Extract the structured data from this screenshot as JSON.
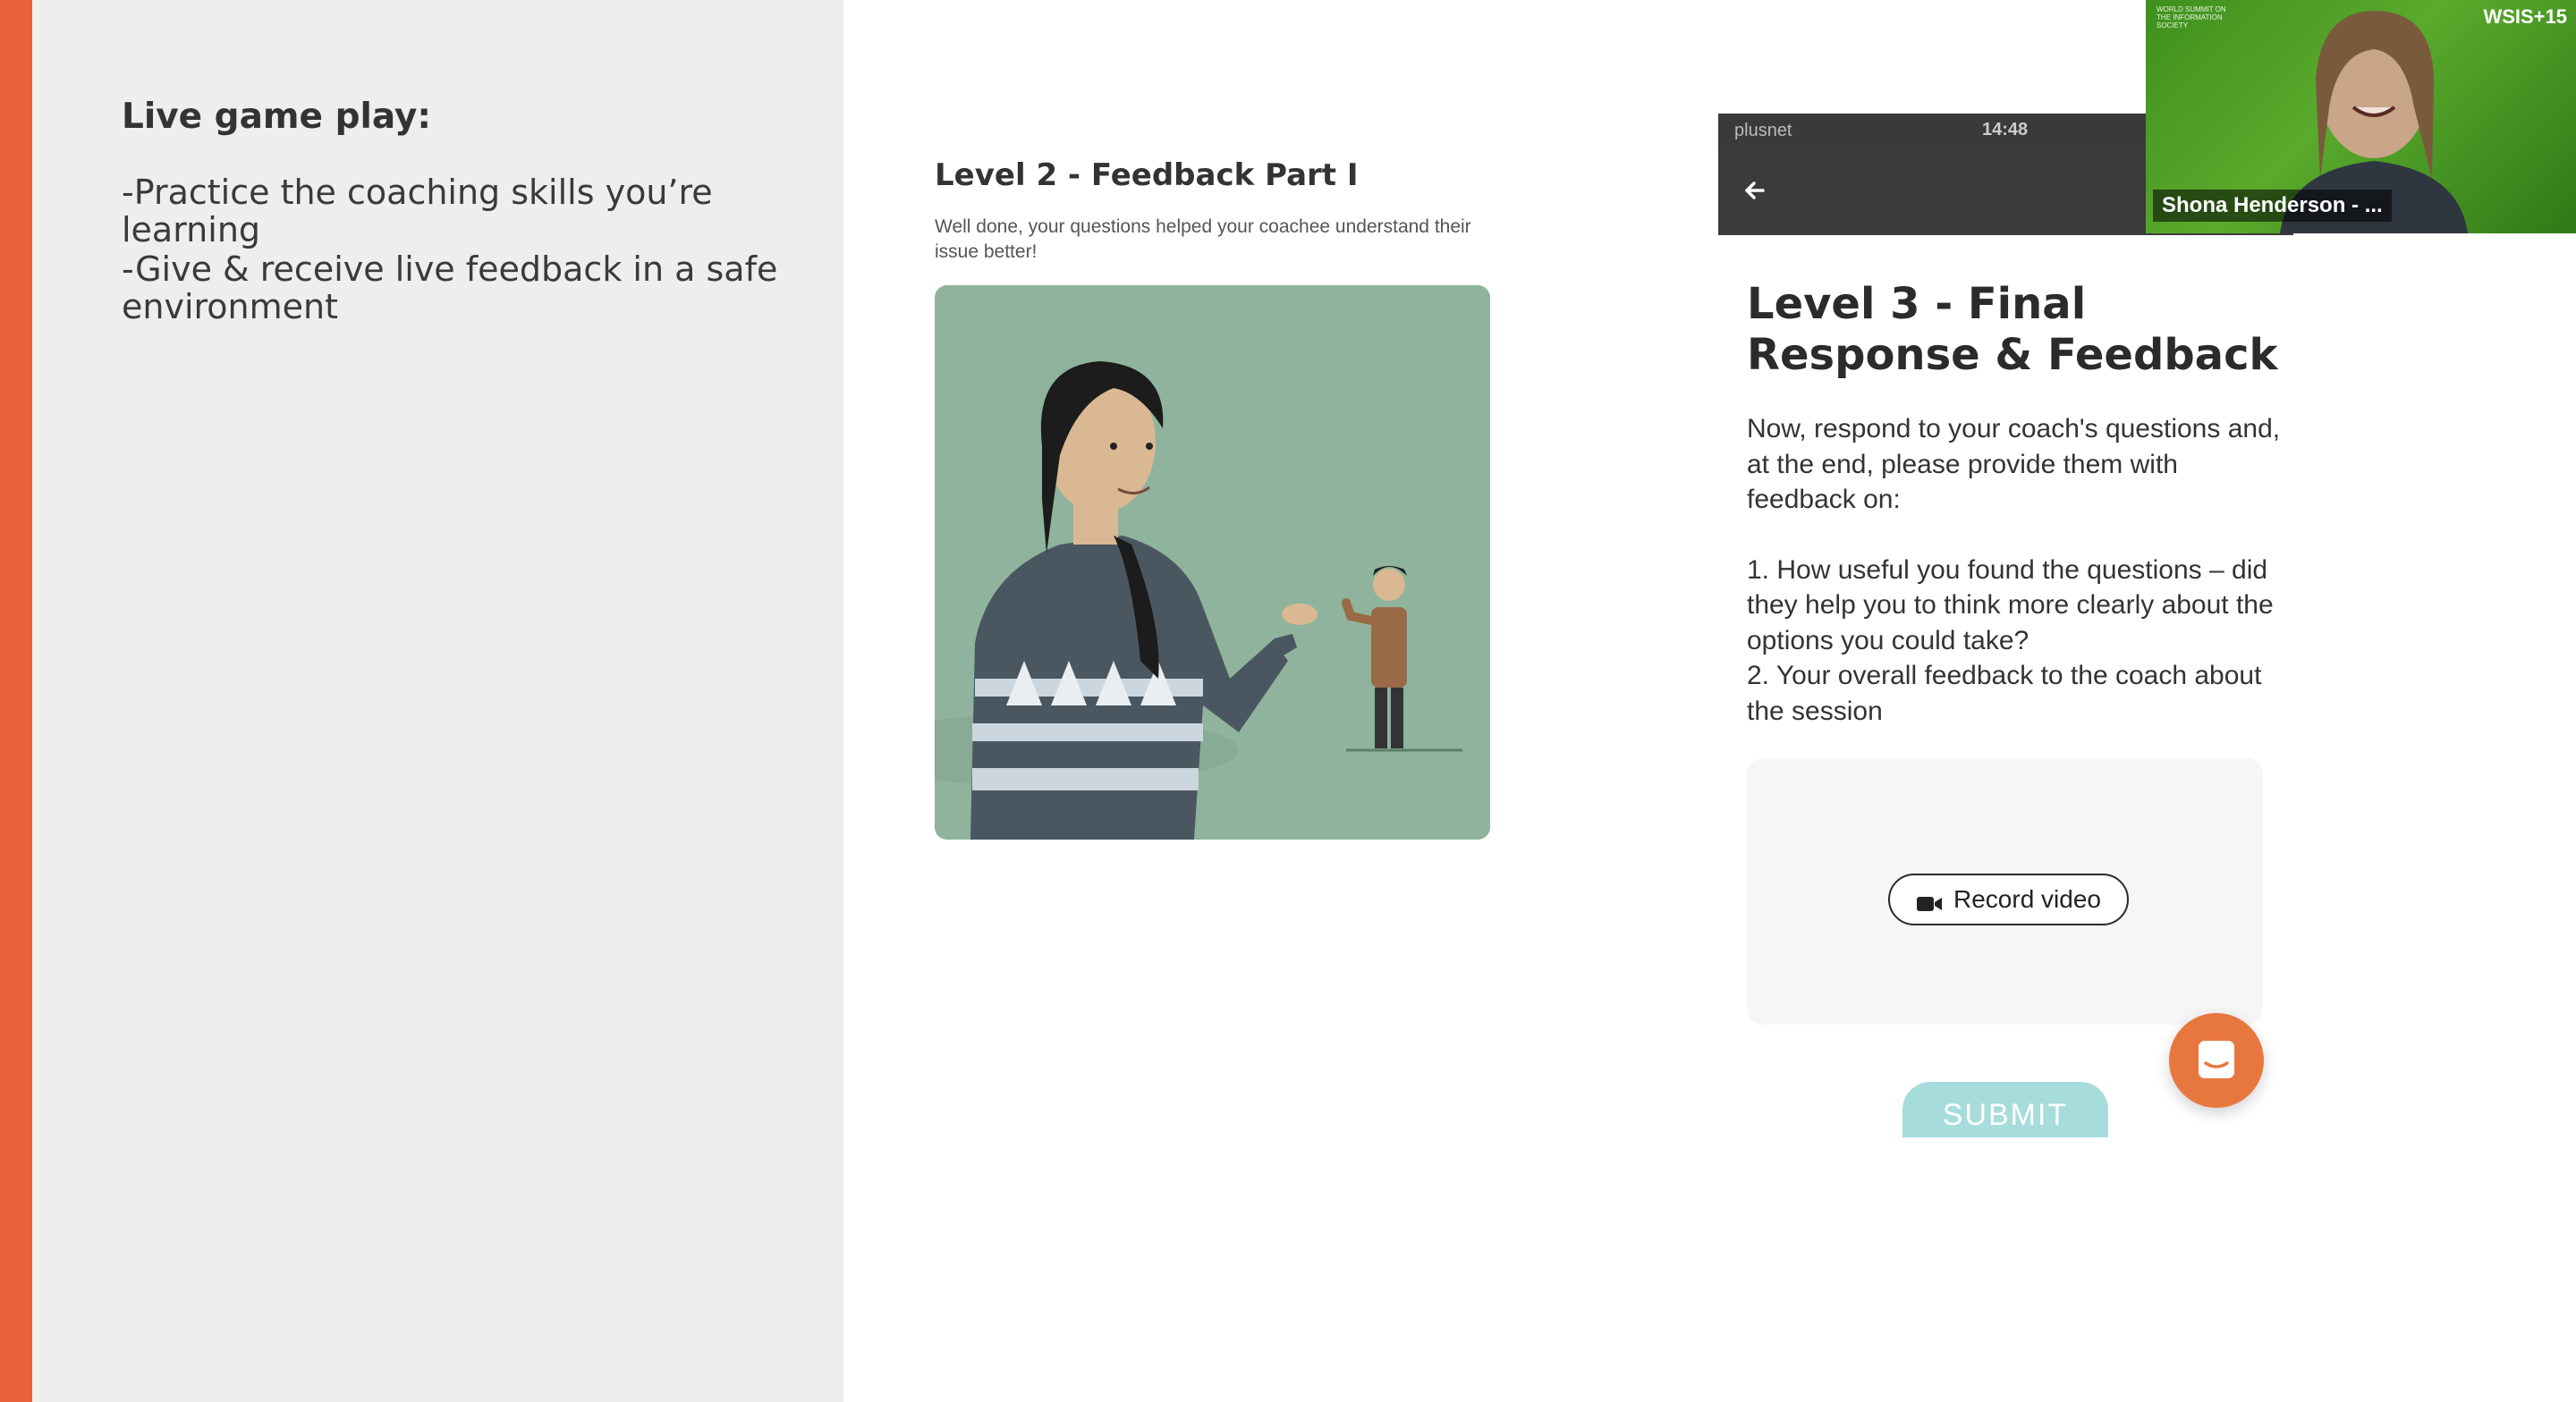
{
  "slide": {
    "accent_color": "#e8613a",
    "left_panel": {
      "heading": "Live game play:",
      "bullets": [
        "-Practice the coaching skills you’re learning",
        "-Give & receive live feedback in a safe environment"
      ]
    },
    "level2": {
      "title": "Level 2 - Feedback Part I",
      "body": "Well done, your questions helped your coachee understand their issue better!",
      "image_icon": "coaching-illustration"
    },
    "phone": {
      "carrier": "plusnet",
      "time": "14:48",
      "back_icon": "arrow-left-icon"
    },
    "level3": {
      "title": "Level 3 - Final Response & Feedback",
      "intro": "Now, respond to your coach's questions and, at the end, please provide them with feedback on:",
      "item1": "1. How useful you found the questions – did they help you to think more clearly about the options you could take?",
      "item2": "2. Your overall feedback to the coach about the session",
      "record_label": "Record video",
      "submit_label": "SUBMIT",
      "submit_color": "#a7dcdc",
      "chat_color": "#e8773f"
    },
    "video_tile": {
      "participant_name": "Shona Henderson - ...",
      "logo_text": "WORLD SUMMIT ON THE INFORMATION SOCIETY",
      "badge": "WSIS+15"
    }
  }
}
